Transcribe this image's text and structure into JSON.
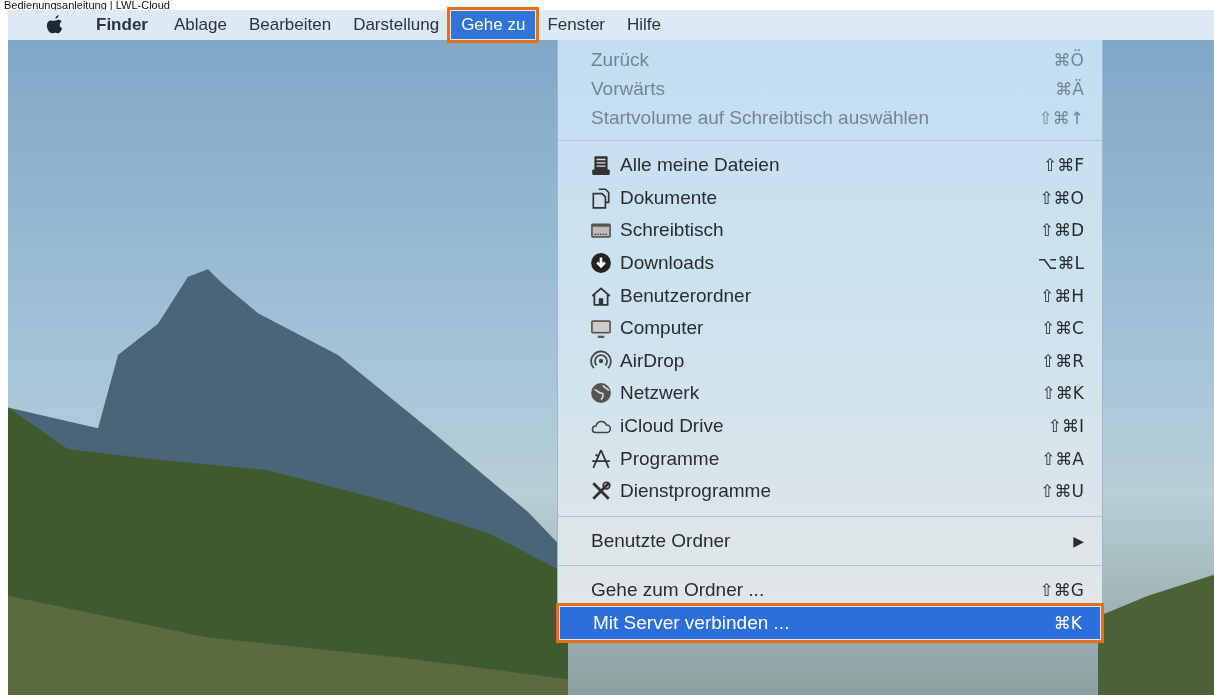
{
  "caption": "Bedienungsanleitung | LWL-Cloud",
  "menu_bar": {
    "items": [
      {
        "kind": "apple",
        "selected": false
      },
      {
        "kind": "app",
        "label": "Finder",
        "selected": false
      },
      {
        "kind": "menu",
        "label": "Ablage",
        "selected": false
      },
      {
        "kind": "menu",
        "label": "Bearbeiten",
        "selected": false
      },
      {
        "kind": "menu",
        "label": "Darstellung",
        "selected": false
      },
      {
        "kind": "menu",
        "label": "Gehe zu",
        "selected": true
      },
      {
        "kind": "menu",
        "label": "Fenster",
        "selected": false
      },
      {
        "kind": "menu",
        "label": "Hilfe",
        "selected": false
      }
    ]
  },
  "menu": {
    "groups": [
      {
        "items": [
          {
            "kind": "plain",
            "label": "Zurück",
            "shortcut": "⌘Ö",
            "disabled": true,
            "selected": false
          },
          {
            "kind": "plain",
            "label": "Vorwärts",
            "shortcut": "⌘Ä",
            "disabled": true,
            "selected": false
          },
          {
            "kind": "plain",
            "label": "Startvolume auf Schreibtisch auswählen",
            "shortcut": "⇧⌘↑",
            "disabled": true,
            "selected": false
          }
        ]
      },
      {
        "items": [
          {
            "kind": "icon",
            "label": "Alle meine Dateien",
            "shortcut": "⇧⌘F",
            "disabled": false,
            "selected": false
          },
          {
            "kind": "icon",
            "label": "Dokumente",
            "shortcut": "⇧⌘O",
            "disabled": false,
            "selected": false
          },
          {
            "kind": "icon",
            "label": "Schreibtisch",
            "shortcut": "⇧⌘D",
            "disabled": false,
            "selected": false
          },
          {
            "kind": "icon",
            "label": "Downloads",
            "shortcut": "⌥⌘L",
            "disabled": false,
            "selected": false
          },
          {
            "kind": "icon",
            "label": "Benutzerordner",
            "shortcut": "⇧⌘H",
            "disabled": false,
            "selected": false
          },
          {
            "kind": "icon",
            "label": "Computer",
            "shortcut": "⇧⌘C",
            "disabled": false,
            "selected": false
          },
          {
            "kind": "icon",
            "label": "AirDrop",
            "shortcut": "⇧⌘R",
            "disabled": false,
            "selected": false
          },
          {
            "kind": "icon",
            "label": "Netzwerk",
            "shortcut": "⇧⌘K",
            "disabled": false,
            "selected": false
          },
          {
            "kind": "icon",
            "label": "iCloud Drive",
            "shortcut": "⇧⌘I",
            "disabled": false,
            "selected": false
          },
          {
            "kind": "icon",
            "label": "Programme",
            "shortcut": "⇧⌘A",
            "disabled": false,
            "selected": false
          },
          {
            "kind": "icon",
            "label": "Dienstprogramme",
            "shortcut": "⇧⌘U",
            "disabled": false,
            "selected": false
          }
        ]
      },
      {
        "items": [
          {
            "kind": "submenu",
            "label": "Benutzte Ordner",
            "shortcut": "▶",
            "disabled": false,
            "selected": false
          }
        ]
      },
      {
        "items": [
          {
            "kind": "plain",
            "label": "Gehe zum Ordner ...",
            "shortcut": "⇧⌘G",
            "disabled": false,
            "selected": false
          },
          {
            "kind": "plain",
            "label": "Mit Server verbinden ...",
            "shortcut": "⌘K",
            "disabled": false,
            "selected": true
          }
        ]
      }
    ]
  }
}
